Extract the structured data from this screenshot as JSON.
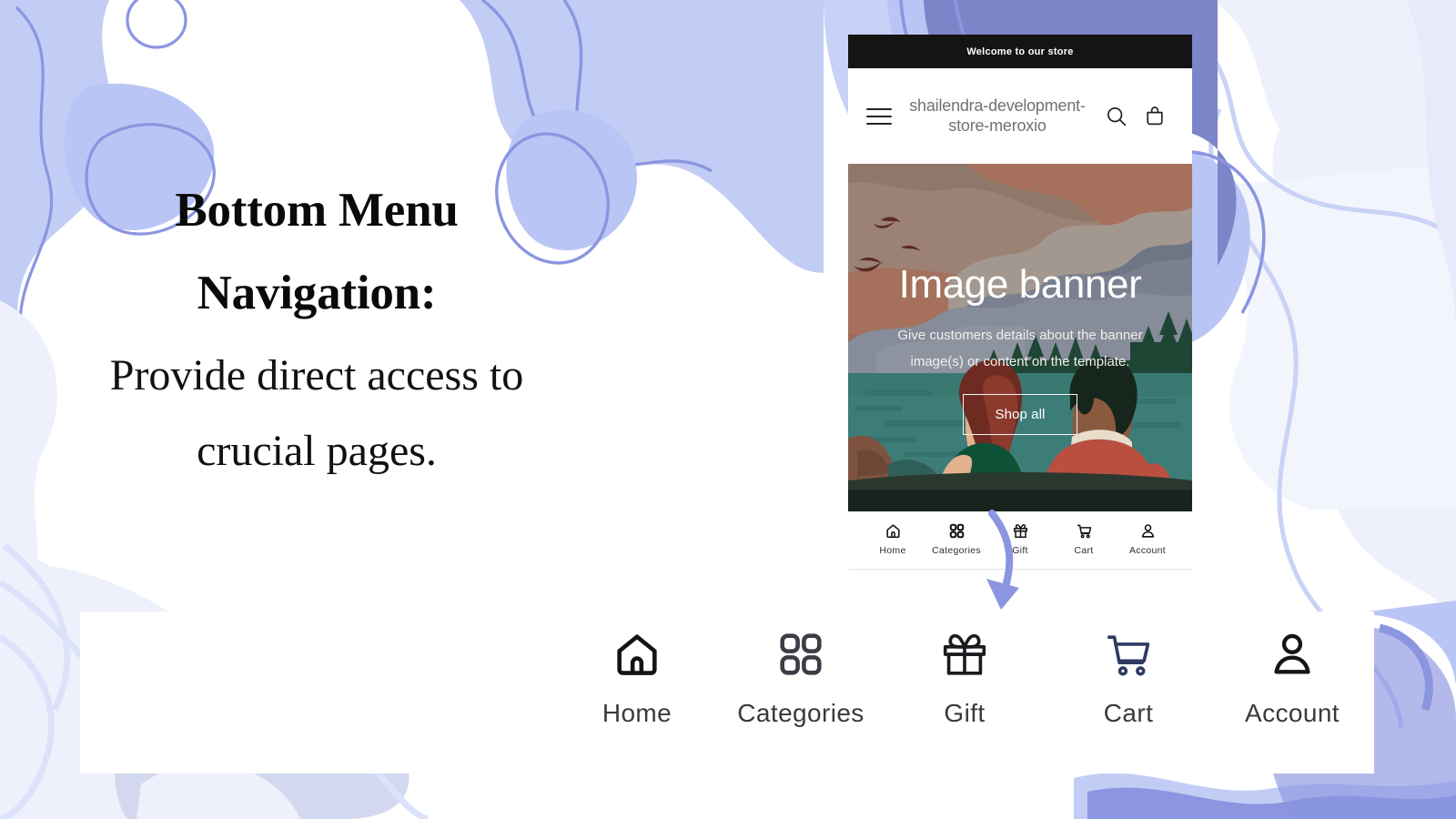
{
  "slide": {
    "headline": "Bottom Menu Navigation:",
    "subcopy": "Provide direct access to crucial pages."
  },
  "colors": {
    "accent_periwinkle": "#8b95e0",
    "blob_light": "#eef1fc",
    "blob_mid": "#b9c6f5",
    "blob_deep": "#7d85c9",
    "announcement_bg": "#141414",
    "cart_icon": "#2f3a63",
    "icon_dark": "#141414",
    "label_gray": "#3a3a3a"
  },
  "phone": {
    "announcement": "Welcome to our store",
    "store_name": "shailendra-development-store-meroxio",
    "header_icons": [
      {
        "name": "hamburger-menu-icon",
        "label": "Menu"
      },
      {
        "name": "search-icon",
        "label": "Search"
      },
      {
        "name": "cart-bag-icon",
        "label": "Cart"
      }
    ],
    "banner": {
      "title": "Image banner",
      "subtitle": "Give customers details about the banner image(s) or content on the template.",
      "button_label": "Shop all",
      "illustration": "two people in a canoe on a teal lake with gray mountains, pine trees, birds and a brown sky"
    },
    "bottom_nav": [
      {
        "label": "Home",
        "icon": "home-icon"
      },
      {
        "label": "Categories",
        "icon": "grid-squares-icon"
      },
      {
        "label": "Gift",
        "icon": "gift-box-icon"
      },
      {
        "label": "Cart",
        "icon": "shopping-cart-icon"
      },
      {
        "label": "Account",
        "icon": "person-icon"
      }
    ]
  },
  "showcase_nav": [
    {
      "label": "Home",
      "icon": "home-icon"
    },
    {
      "label": "Categories",
      "icon": "grid-squares-icon"
    },
    {
      "label": "Gift",
      "icon": "gift-box-icon"
    },
    {
      "label": "Cart",
      "icon": "shopping-cart-icon"
    },
    {
      "label": "Account",
      "icon": "person-icon"
    }
  ],
  "annotation": {
    "arrow": "curved-down-arrow"
  }
}
